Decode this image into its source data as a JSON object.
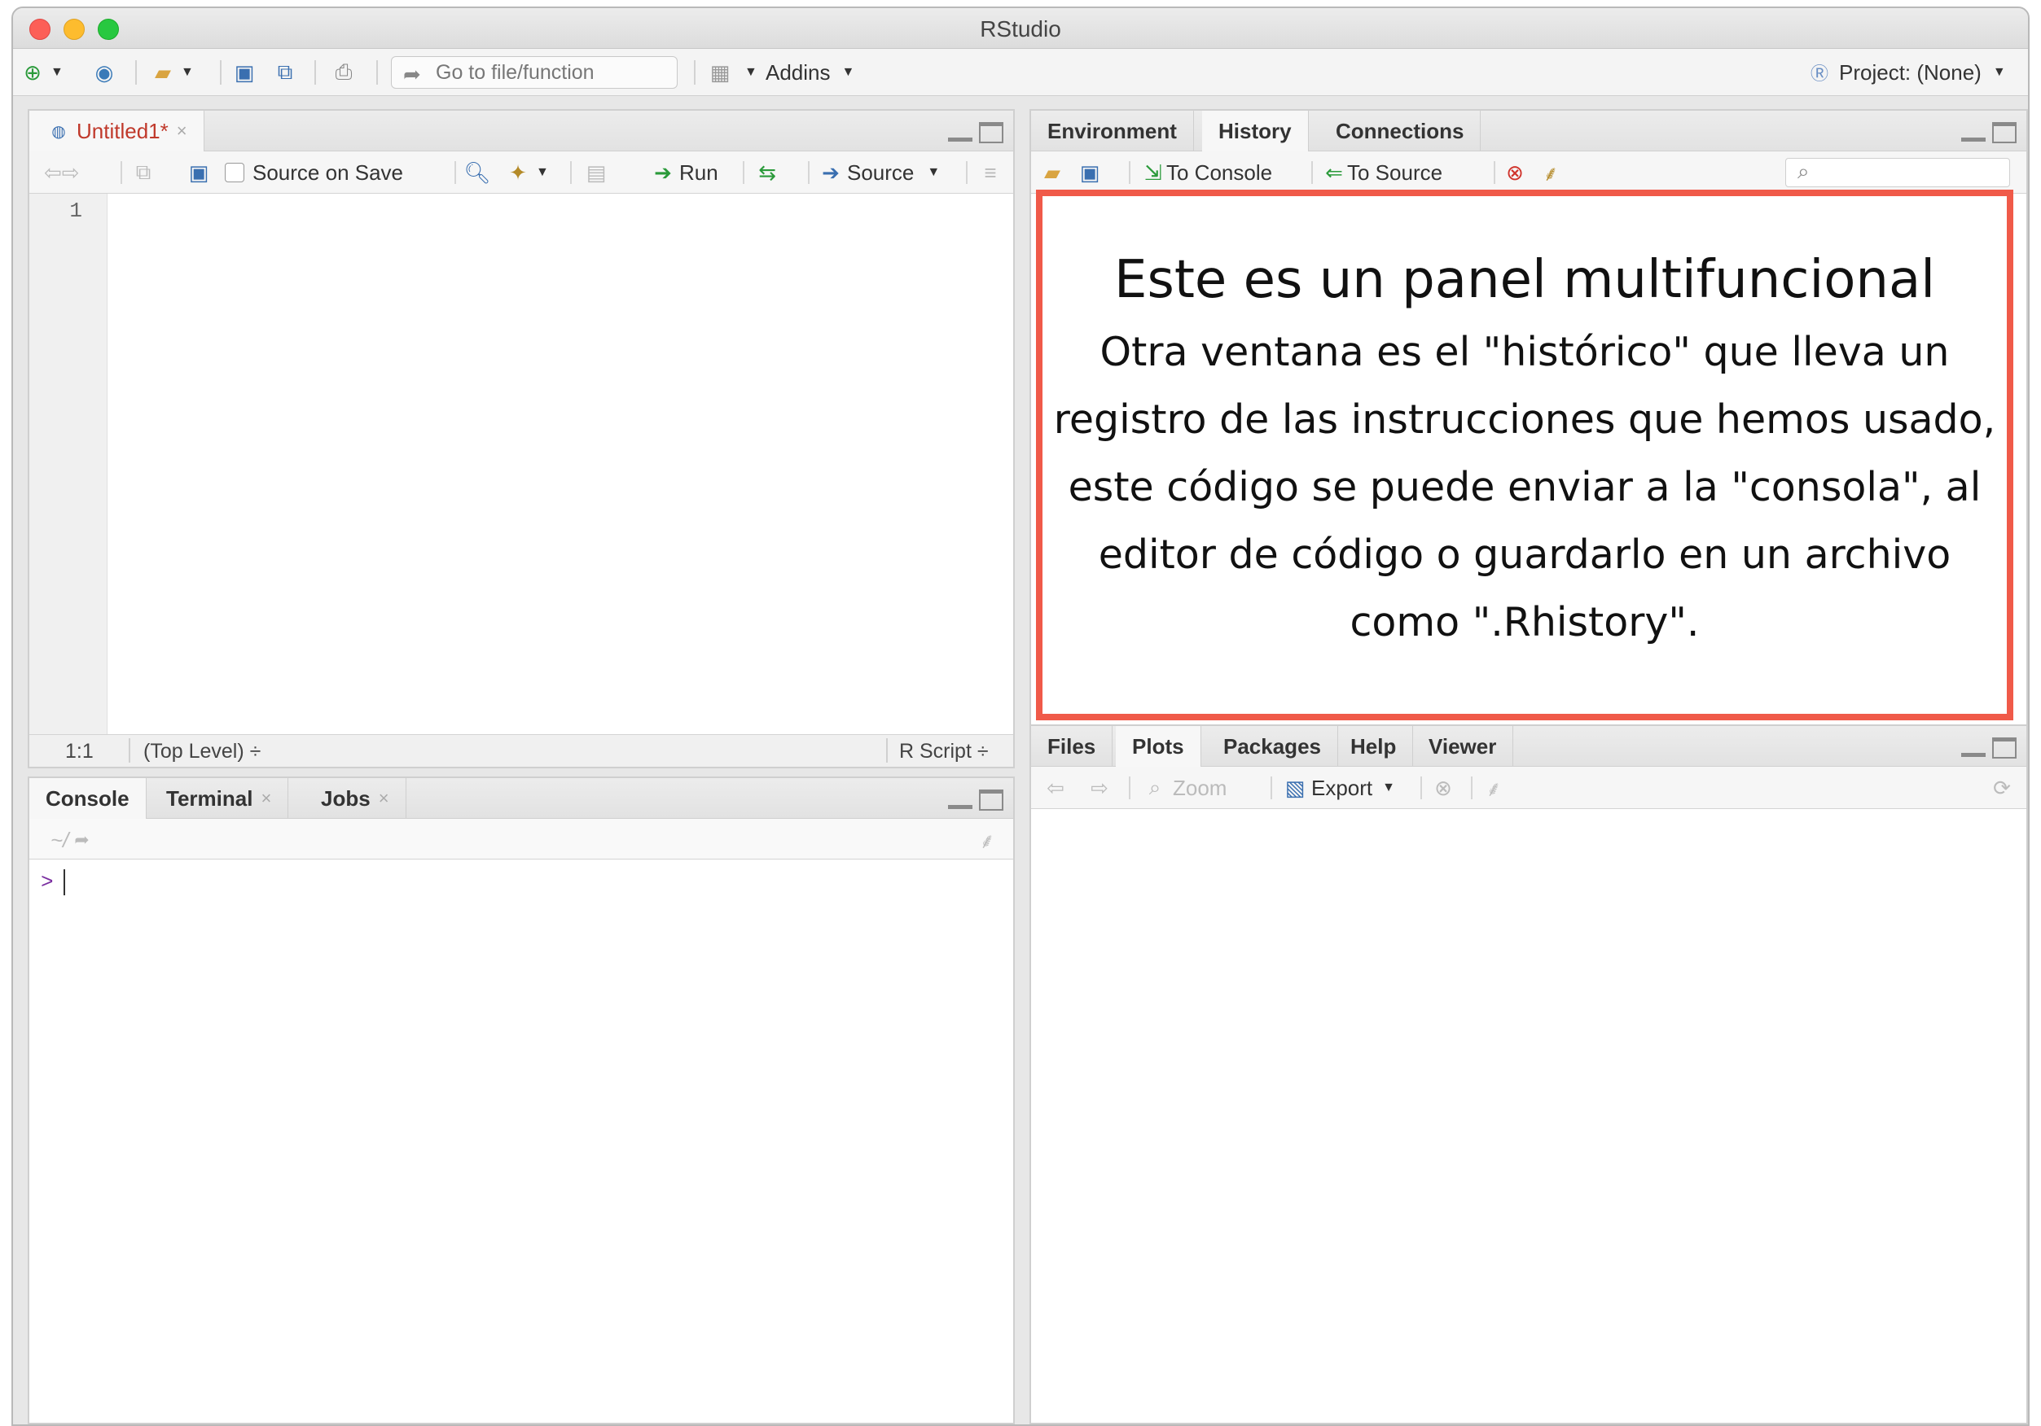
{
  "window": {
    "title": "RStudio"
  },
  "toolbar": {
    "goto_placeholder": "Go to file/function",
    "addins_label": "Addins",
    "project_label": "Project: (None)"
  },
  "source_pane": {
    "tab_label": "Untitled1*",
    "source_on_save_label": "Source on Save",
    "run_label": "Run",
    "source_label": "Source",
    "line_number": "1",
    "status_position": "1:1",
    "status_scope": "(Top Level) ÷",
    "status_type": "R Script ÷"
  },
  "console_pane": {
    "tabs": [
      "Console",
      "Terminal",
      "Jobs"
    ],
    "path": "~/",
    "prompt": ">"
  },
  "env_pane": {
    "tabs": [
      "Environment",
      "History",
      "Connections"
    ],
    "to_console_label": "To Console",
    "to_source_label": "To Source"
  },
  "files_pane": {
    "tabs": [
      "Files",
      "Plots",
      "Packages",
      "Help",
      "Viewer"
    ],
    "zoom_label": "Zoom",
    "export_label": "Export"
  },
  "callout": {
    "title": "Este es un panel multifuncional",
    "body": "Otra ventana es el \"histórico\" que lleva un registro de las instrucciones que hemos usado, este código se puede enviar a la \"consola\", al editor de código o guardarlo en un archivo como \".Rhistory\".",
    "border_color": "#f05a49"
  }
}
